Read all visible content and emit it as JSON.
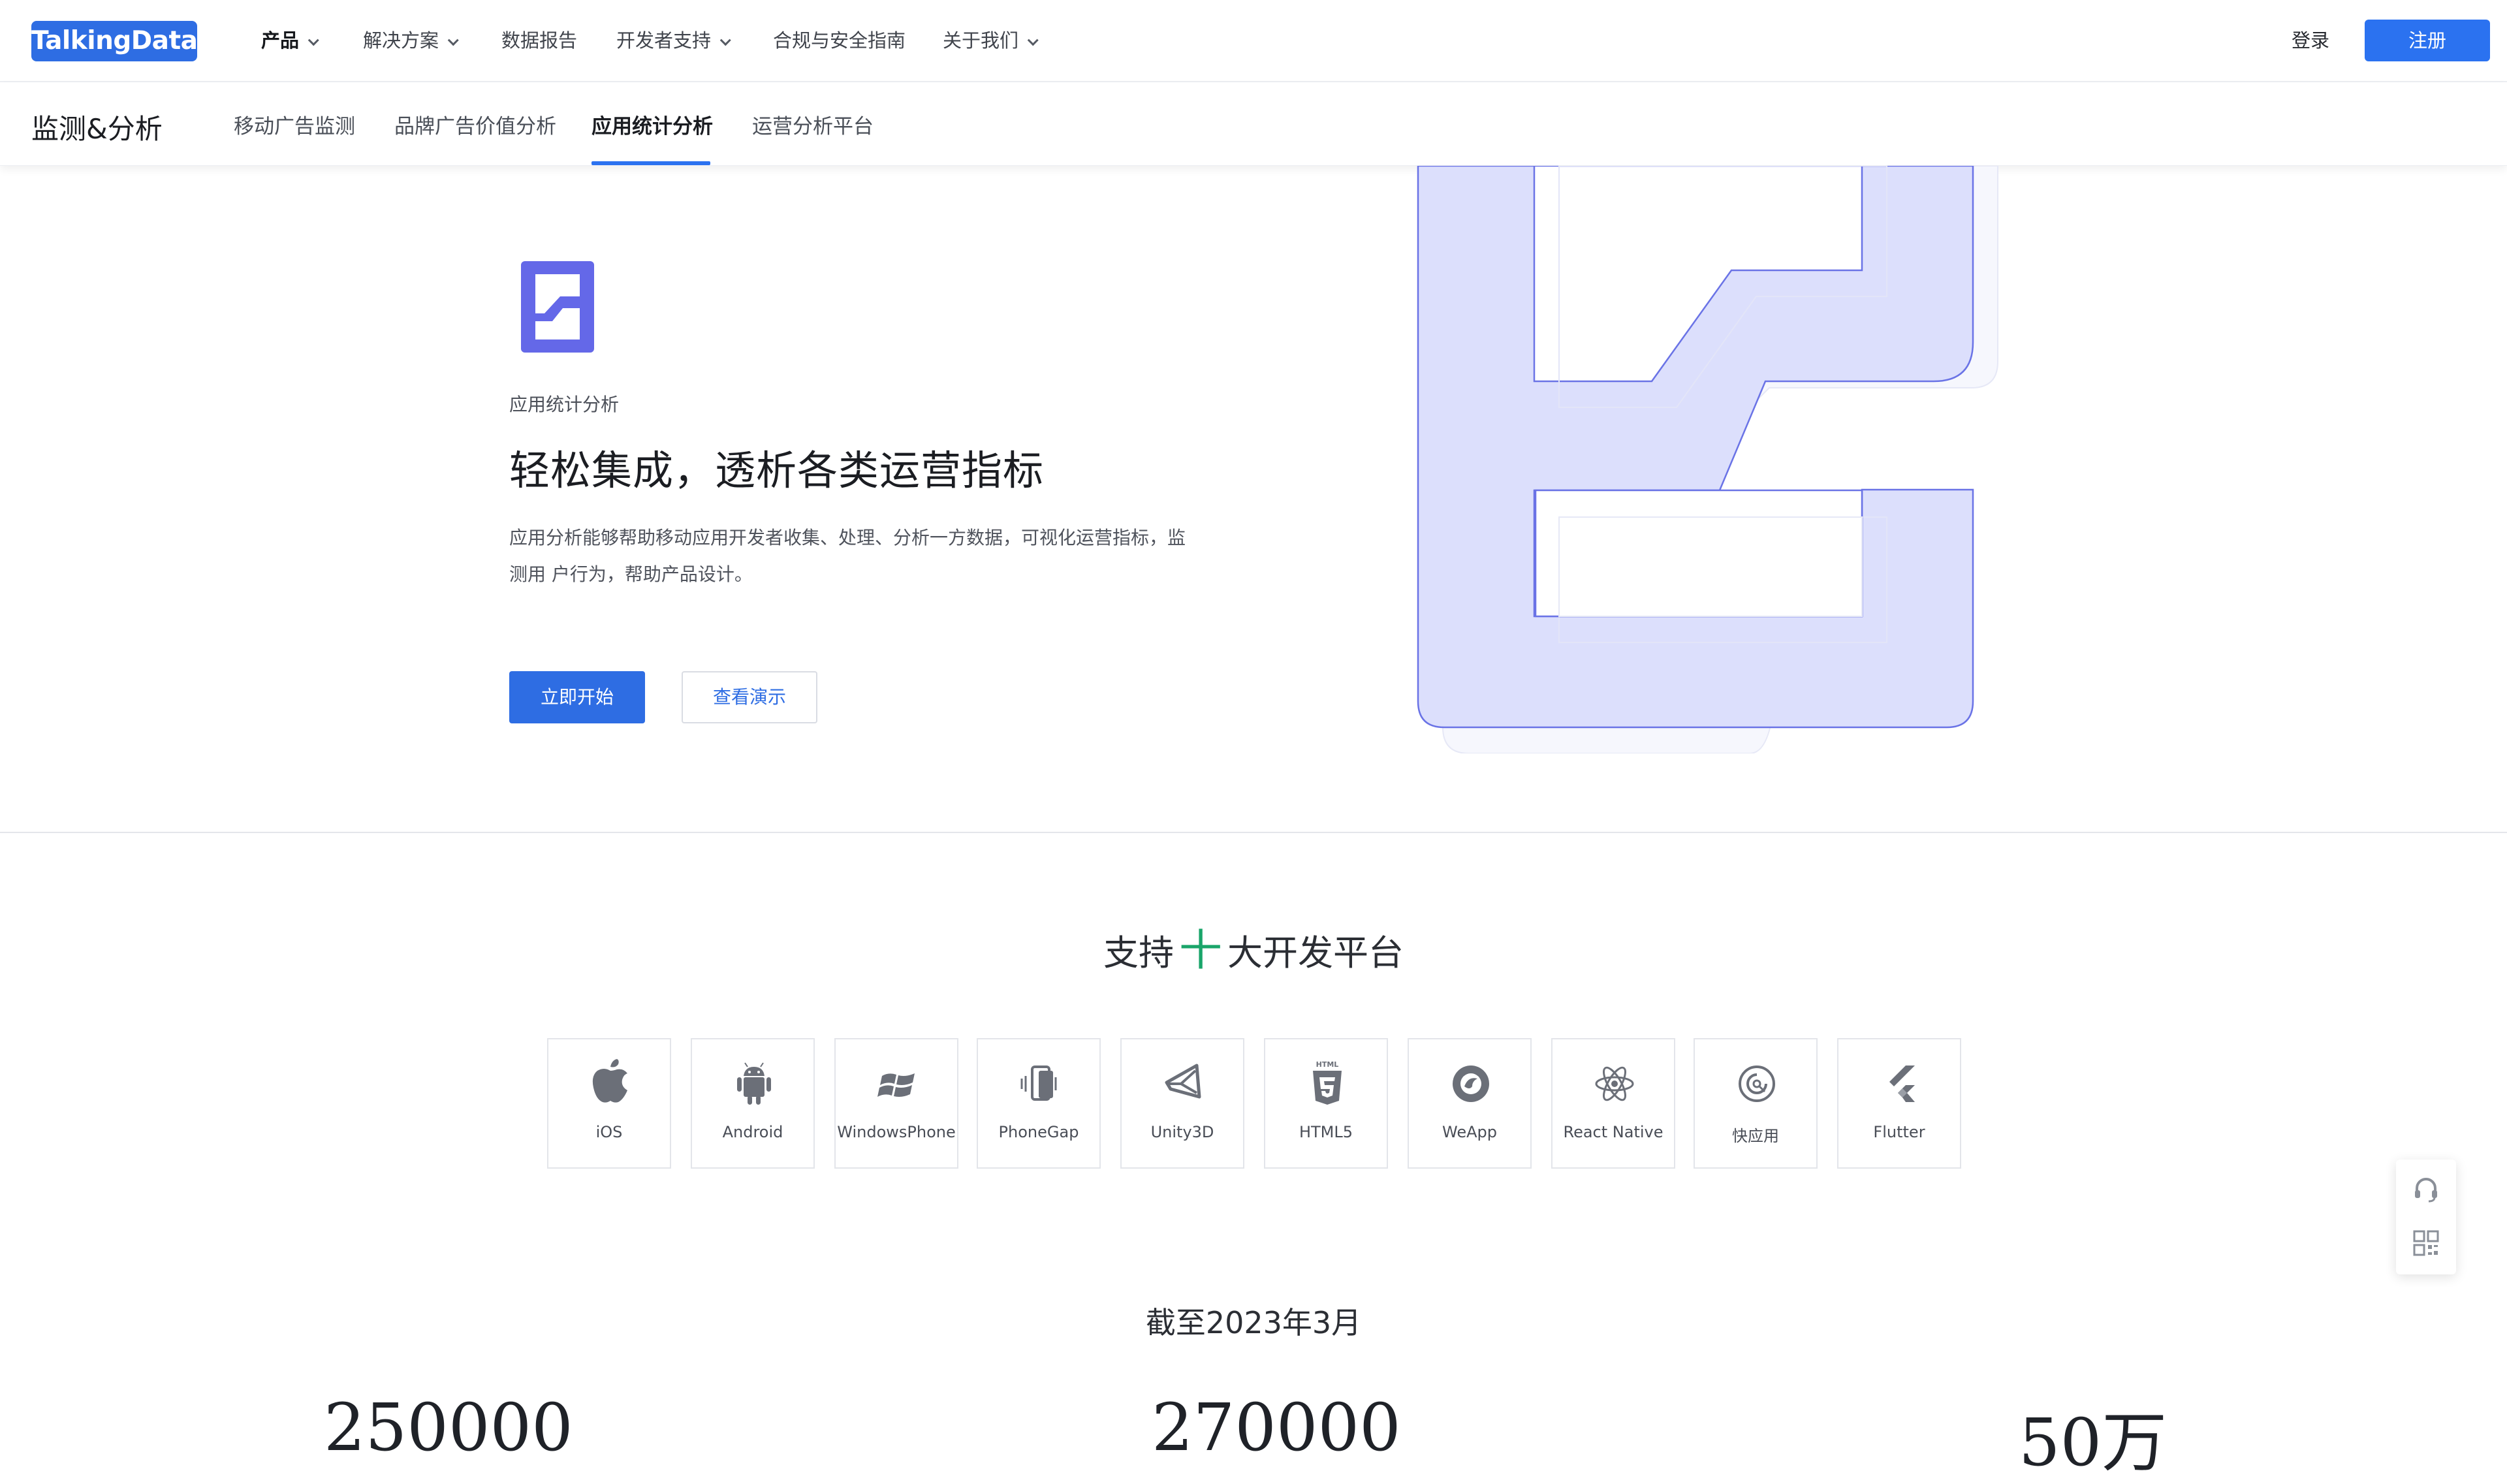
{
  "brand": {
    "logo_text": "TalkingData",
    "accent": "#2e6de3"
  },
  "topnav": {
    "items": [
      {
        "label": "产品",
        "has_dropdown": true,
        "active": true
      },
      {
        "label": "解决方案",
        "has_dropdown": true
      },
      {
        "label": "数据报告",
        "has_dropdown": false
      },
      {
        "label": "开发者支持",
        "has_dropdown": true
      },
      {
        "label": "合规与安全指南",
        "has_dropdown": false
      },
      {
        "label": "关于我们",
        "has_dropdown": true
      }
    ],
    "login": "登录",
    "register": "注册"
  },
  "subnav": {
    "title": "监测&分析",
    "items": [
      {
        "label": "移动广告监测"
      },
      {
        "label": "品牌广告价值分析"
      },
      {
        "label": "应用统计分析",
        "active": true
      },
      {
        "label": "运营分析平台"
      }
    ]
  },
  "hero": {
    "eyebrow": "应用统计分析",
    "title": "轻松集成，透析各类运营指标",
    "description": "应用分析能够帮助移动应用开发者收集、处理、分析一方数据，可视化运营指标，监测用 户行为，帮助产品设计。",
    "primary_button": "立即开始",
    "secondary_button": "查看演示"
  },
  "platforms": {
    "title_prefix": "支持",
    "title_number": "十",
    "title_suffix": "大开发平台",
    "items": [
      {
        "label": "iOS",
        "icon": "apple-icon"
      },
      {
        "label": "Android",
        "icon": "android-icon"
      },
      {
        "label": "WindowsPhone",
        "icon": "windows-icon"
      },
      {
        "label": "PhoneGap",
        "icon": "phonegap-icon"
      },
      {
        "label": "Unity3D",
        "icon": "unity-icon"
      },
      {
        "label": "HTML5",
        "icon": "html5-icon"
      },
      {
        "label": "WeApp",
        "icon": "weapp-icon"
      },
      {
        "label": "React Native",
        "icon": "react-icon"
      },
      {
        "label": "快应用",
        "icon": "quickapp-icon"
      },
      {
        "label": "Flutter",
        "icon": "flutter-icon"
      }
    ]
  },
  "stats": {
    "caption": "截至2023年3月",
    "values": [
      "250000",
      "270000",
      "50万"
    ]
  }
}
